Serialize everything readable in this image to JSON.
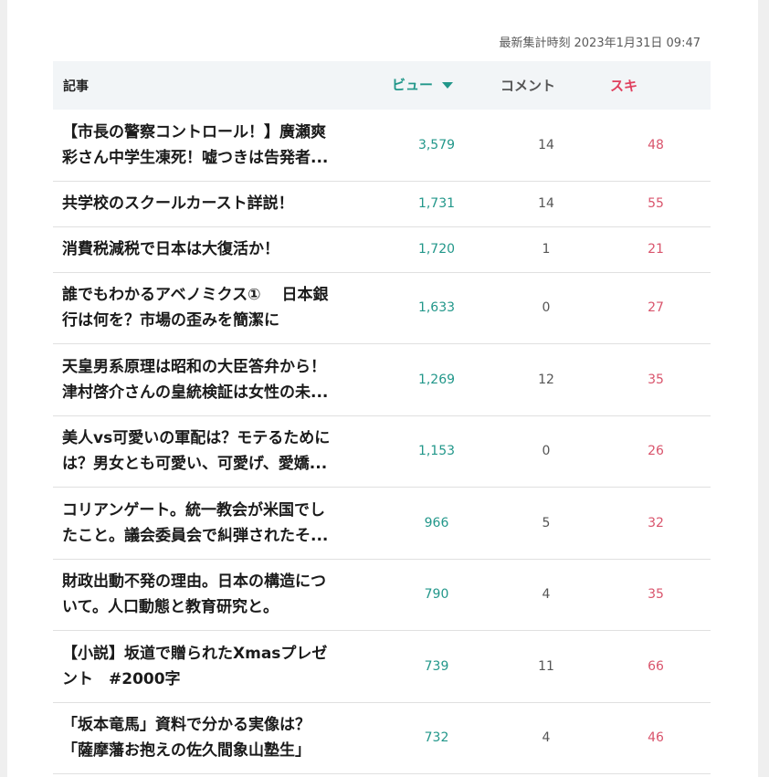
{
  "header": {
    "timestamp_label": "最新集計時刻",
    "timestamp_value": "2023年1月31日 09:47"
  },
  "columns": {
    "article": "記事",
    "views": "ビュー",
    "comments": "コメント",
    "likes": "スキ"
  },
  "colors": {
    "views": "#22978a",
    "likes": "#d9546c",
    "header_bg": "#f2f5f7"
  },
  "rows": [
    {
      "line1": "【市長の警察コントロール！】廣瀬爽",
      "line2": "彩さん中学生凍死！嘘つきは告発者...",
      "views": "3,579",
      "comments": "14",
      "likes": "48"
    },
    {
      "line1": "共学校のスクールカースト詳説！",
      "line2": "",
      "views": "1,731",
      "comments": "14",
      "likes": "55"
    },
    {
      "line1": "消費税減税で日本は大復活か！",
      "line2": "",
      "views": "1,720",
      "comments": "1",
      "likes": "21"
    },
    {
      "line1": "誰でもわかるアベノミクス①　 日本銀",
      "line2": "行は何を？市場の歪みを簡潔に",
      "views": "1,633",
      "comments": "0",
      "likes": "27"
    },
    {
      "line1": "天皇男系原理は昭和の大臣答弁から！",
      "line2": "津村啓介さんの皇統検証は女性の未...",
      "views": "1,269",
      "comments": "12",
      "likes": "35"
    },
    {
      "line1": "美人vs可愛いの軍配は？モテるために",
      "line2": "は？男女とも可愛い、可愛げ、愛嬌...",
      "views": "1,153",
      "comments": "0",
      "likes": "26"
    },
    {
      "line1": "コリアンゲート。統一教会が米国でし",
      "line2": "たこと。議会委員会で糾弾されたそ...",
      "views": "966",
      "comments": "5",
      "likes": "32"
    },
    {
      "line1": "財政出動不発の理由。日本の構造につ",
      "line2": "いて。人口動態と教育研究と。",
      "views": "790",
      "comments": "4",
      "likes": "35"
    },
    {
      "line1": "【小説】坂道で贈られたXmasプレゼ",
      "line2": "ント　#2000字",
      "views": "739",
      "comments": "11",
      "likes": "66"
    },
    {
      "line1": "「坂本竜馬」資料で分かる実像は？",
      "line2": "「薩摩藩お抱えの佐久間象山塾生」",
      "views": "732",
      "comments": "4",
      "likes": "46"
    }
  ]
}
